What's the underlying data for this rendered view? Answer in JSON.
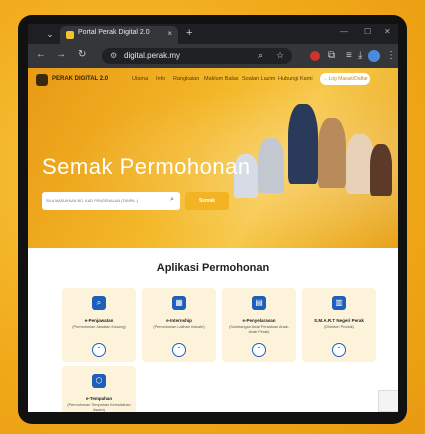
{
  "browser": {
    "tab_title": "Portal Perak Digital 2.0",
    "tab_close": "×",
    "new_tab": "+",
    "url": "digital.perak.my"
  },
  "site": {
    "logo": "PERAK DIGITAL 2.0",
    "nav": [
      "Utama",
      "Info",
      "Rangkaian",
      "Maklum Balas",
      "Soalan Lazim",
      "Hubungi Kami"
    ],
    "login": "→ Log Masuk/Daftar"
  },
  "hero": {
    "title": "Semak Permohonan",
    "search_placeholder": "SILA MASUKKAN NO. KAD PENGENALAN (TANPA -)",
    "search_button": "Semak"
  },
  "section": {
    "title": "Aplikasi Permohonan"
  },
  "cards": [
    {
      "title": "e-Penjawatan",
      "subtitle": "(Permohonan Jawatan Kosong)"
    },
    {
      "title": "e-Internship",
      "subtitle": "(Permohonan Latihan Industri)"
    },
    {
      "title": "e-Penyelarasan",
      "subtitle": "(Sumbangan Awal Persatuan Anak-Anak Perak)"
    },
    {
      "title": "S.M.A.R.T Negeri Perak",
      "subtitle": "(Direktori Produk)"
    },
    {
      "title": "e-Tempahan",
      "subtitle": "(Permohonan Tempahan Kemudahan Awam)"
    }
  ],
  "colors": {
    "accent": "#f2b422",
    "icon_blue": "#1e5fb8",
    "card_bg": "#fdf3da"
  }
}
